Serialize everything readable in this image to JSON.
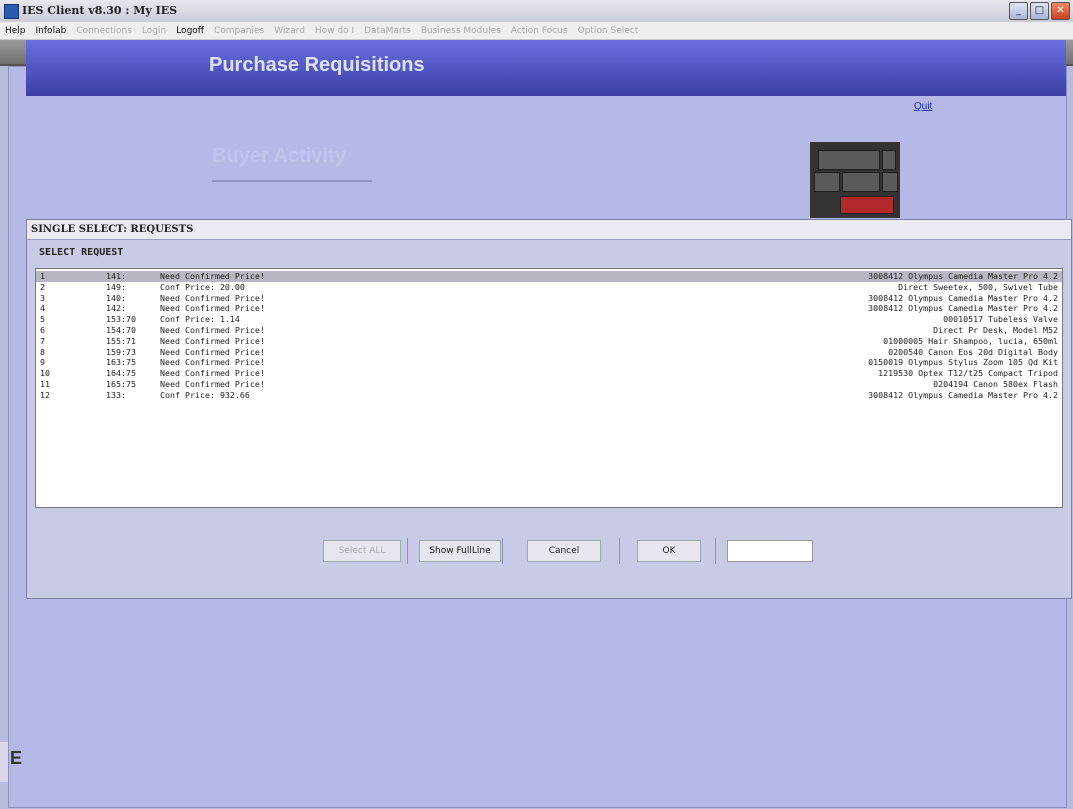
{
  "window": {
    "title": "IES Client v8.30 : My IES",
    "buttons": {
      "minimize": "_",
      "maximize": "□",
      "close": "✕"
    }
  },
  "menubar": [
    {
      "label": "Help",
      "active": true
    },
    {
      "label": "Infolab",
      "active": true
    },
    {
      "label": "Connections",
      "active": false
    },
    {
      "label": "Login",
      "active": false
    },
    {
      "label": "Logoff",
      "active": true
    },
    {
      "label": "Companies",
      "active": false
    },
    {
      "label": "Wizard",
      "active": false
    },
    {
      "label": "How do I",
      "active": false
    },
    {
      "label": "DataMarts",
      "active": false
    },
    {
      "label": "Business Modules",
      "active": false
    },
    {
      "label": "Action Focus",
      "active": false
    },
    {
      "label": "Option Select",
      "active": false
    }
  ],
  "page": {
    "banner_title": "Purchase Requisitions",
    "quit_label": "Quit",
    "subtitle": "Buyer Activity"
  },
  "dialog": {
    "title": "SINGLE SELECT: REQUESTS",
    "section": "SELECT REQUEST",
    "rows": [
      {
        "no": "1",
        "ref": "141:",
        "desc": "Need Confirmed Price!",
        "item": "3008412 Olympus Camedia Master Pro 4.2"
      },
      {
        "no": "2",
        "ref": "149:",
        "desc": "Conf Price: 20.00",
        "item": "Direct Sweetex, 500, Swivel Tube"
      },
      {
        "no": "3",
        "ref": "140:",
        "desc": "Need Confirmed Price!",
        "item": "3008412 Olympus Camedia Master Pro 4.2"
      },
      {
        "no": "4",
        "ref": "142:",
        "desc": "Need Confirmed Price!",
        "item": "3008412 Olympus Camedia Master Pro 4.2"
      },
      {
        "no": "5",
        "ref": "153:70",
        "desc": "Conf Price: 1.14",
        "item": "00010517 Tubeless Valve"
      },
      {
        "no": "6",
        "ref": "154:70",
        "desc": "Need Confirmed Price!",
        "item": "Direct Pr Desk, Model M52"
      },
      {
        "no": "7",
        "ref": "155:71",
        "desc": "Need Confirmed Price!",
        "item": "01000005 Hair Shampoo, lucia, 650ml"
      },
      {
        "no": "8",
        "ref": "159:73",
        "desc": "Need Confirmed Price!",
        "item": "0200540 Canon Eos 20d Digital Body"
      },
      {
        "no": "9",
        "ref": "163:75",
        "desc": "Need Confirmed Price!",
        "item": "0150019 Olympus Stylus Zoom 105 Qd Kit"
      },
      {
        "no": "10",
        "ref": "164:75",
        "desc": "Need Confirmed Price!",
        "item": "1219530 Optex T12/t25 Compact Tripod"
      },
      {
        "no": "11",
        "ref": "165:75",
        "desc": "Need Confirmed Price!",
        "item": "0204194 Canon 580ex Flash"
      },
      {
        "no": "12",
        "ref": "133:",
        "desc": "Conf Price: 932.66",
        "item": "3008412 Olympus Camedia Master Pro 4.2"
      }
    ],
    "selected_row": 1,
    "buttons": {
      "select_all": "Select ALL",
      "show_full_line": "Show FullLine",
      "cancel": "Cancel",
      "ok": "OK"
    },
    "input_value": ""
  },
  "sidebar_letter": "E"
}
